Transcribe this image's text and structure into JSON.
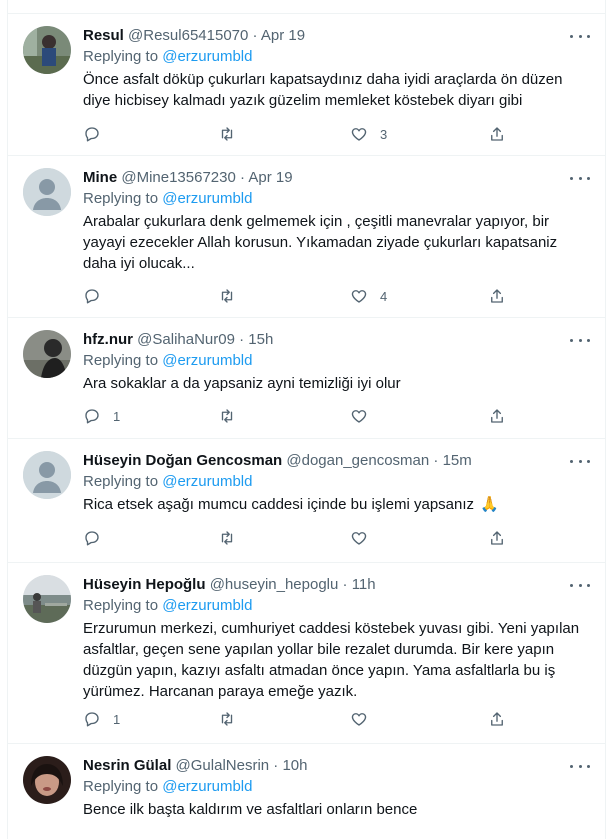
{
  "replies": [
    {
      "name": "Resul",
      "handle": "@Resul65415070",
      "time": "Apr 19",
      "replying_label": "Replying to",
      "replying_handle": "@erzurumbld",
      "text": "Önce asfalt döküp çukurları kapatsaydınız daha iyidi araçlarda ön düzen diye hicbisey kalmadı yazık güzelim memleket köstebek diyarı gibi",
      "likes": "3",
      "retweets": "",
      "replies": "",
      "avatar": "photo-person-icon"
    },
    {
      "name": "Mine",
      "handle": "@Mine13567230",
      "time": "Apr 19",
      "replying_label": "Replying to",
      "replying_handle": "@erzurumbld",
      "text": "Arabalar çukurlara denk gelmemek için , çeşitli manevralar yapıyor, bir yayayi ezecekler Allah korusun. Yıkamadan ziyade çukurları kapatsaniz daha iyi olucak...",
      "likes": "4",
      "retweets": "",
      "replies": "",
      "avatar": "default-avatar-icon"
    },
    {
      "name": "hfz.nur",
      "handle": "@SalihaNur09",
      "time": "15h",
      "replying_label": "Replying to",
      "replying_handle": "@erzurumbld",
      "text": "Ara sokaklar a da yapsaniz ayni temizliği iyi olur",
      "likes": "",
      "retweets": "",
      "replies": "1",
      "avatar": "photo-dark-icon"
    },
    {
      "name": "Hüseyin Doğan Gencosman",
      "handle": "@dogan_gencosman",
      "time": "15m",
      "replying_label": "Replying to",
      "replying_handle": "@erzurumbld",
      "text": "Rica etsek aşağı mumcu caddesi içinde bu işlemi yapsanız",
      "emoji": "🙏",
      "likes": "",
      "retweets": "",
      "replies": "",
      "avatar": "default-avatar-icon"
    },
    {
      "name": "Hüseyin Hepoğlu",
      "handle": "@huseyin_hepoglu",
      "time": "11h",
      "replying_label": "Replying to",
      "replying_handle": "@erzurumbld",
      "text": "Erzurumun merkezi, cumhuriyet caddesi köstebek yuvası gibi. Yeni yapılan asfaltlar, geçen sene yapılan  yollar bile rezalet durumda. Bir kere yapın düzgün yapın, kazıyı asfaltı atmadan önce yapın. Yama asfaltlarla bu iş yürümez. Harcanan paraya emeğe yazık.",
      "likes": "",
      "retweets": "",
      "replies": "1",
      "avatar": "photo-landscape-icon"
    },
    {
      "name": "Nesrin Gülal",
      "handle": "@GulalNesrin",
      "time": "10h",
      "replying_label": "Replying to",
      "replying_handle": "@erzurumbld",
      "text": "Bence ilk başta kaldırım ve asfaltlari onların bence",
      "likes": "",
      "retweets": "",
      "replies": "",
      "avatar": "photo-woman-icon"
    }
  ],
  "separator": "·"
}
